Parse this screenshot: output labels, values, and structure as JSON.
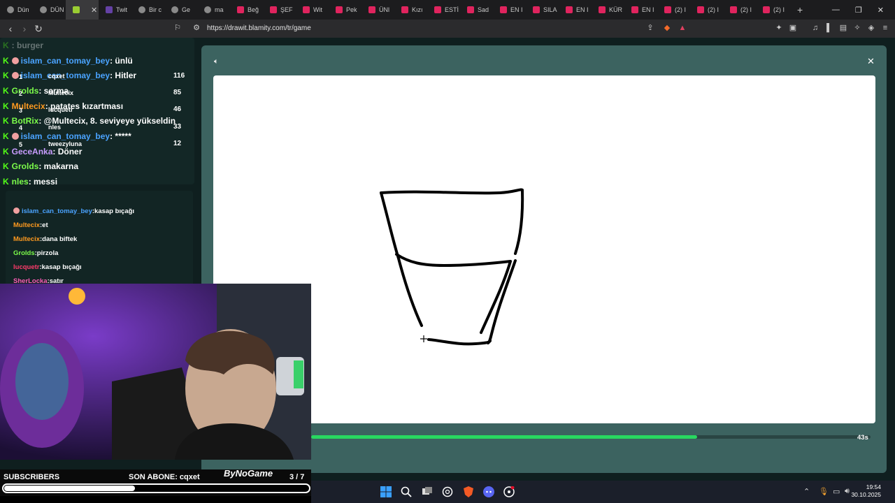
{
  "tabs": [
    {
      "label": "Dün",
      "icon": "globe-icon"
    },
    {
      "label": "DÜN",
      "icon": "globe-icon"
    },
    {
      "label": "",
      "icon": "drawit-icon",
      "active": true
    },
    {
      "label": "Twit",
      "icon": "twitch-icon"
    },
    {
      "label": "Bir c",
      "icon": "globe-icon"
    },
    {
      "label": "Ge",
      "icon": "globe-icon"
    },
    {
      "label": "ma",
      "icon": "globe-icon"
    },
    {
      "label": "Beğ",
      "icon": "youtube-icon"
    },
    {
      "label": "ŞEF",
      "icon": "youtube-icon"
    },
    {
      "label": "Wit",
      "icon": "youtube-icon"
    },
    {
      "label": "Pek",
      "icon": "youtube-icon"
    },
    {
      "label": "ÜNl",
      "icon": "youtube-icon"
    },
    {
      "label": "Kızı",
      "icon": "youtube-icon"
    },
    {
      "label": "ESTİ",
      "icon": "youtube-icon"
    },
    {
      "label": "Sad",
      "icon": "youtube-icon"
    },
    {
      "label": "EN I",
      "icon": "youtube-icon"
    },
    {
      "label": "SILA",
      "icon": "youtube-icon"
    },
    {
      "label": "EN I",
      "icon": "youtube-icon"
    },
    {
      "label": "KÜR",
      "icon": "youtube-icon"
    },
    {
      "label": "EN I",
      "icon": "youtube-icon"
    },
    {
      "label": "(2) I",
      "icon": "youtube-icon"
    },
    {
      "label": "(2) I",
      "icon": "youtube-icon"
    },
    {
      "label": "(2) I",
      "icon": "youtube-icon"
    },
    {
      "label": "(2) I",
      "icon": "youtube-icon"
    }
  ],
  "address": {
    "url": "https://drawit.blamity.com/tr/game"
  },
  "chat": [
    {
      "user": "",
      "text": ": burger",
      "color": "#ff5050"
    },
    {
      "user": "islam_can_tomay_bey",
      "text": ": ünlü",
      "color": "#4aa3ff"
    },
    {
      "user": "islam_can_tomay_bey",
      "text": ": Hitler",
      "color": "#4aa3ff"
    },
    {
      "user": "Grolds",
      "text": ": sarma",
      "color": "#7cfc4a"
    },
    {
      "user": "Multecix",
      "text": ": patates kızartması",
      "color": "#ff9a1f"
    },
    {
      "user": "BotRix",
      "text": ": @Multecix, 8. seviyeye yükseldin",
      "color": "#7cfc4a"
    },
    {
      "user": "islam_can_tomay_bey",
      "text": ": *****",
      "color": "#4aa3ff"
    },
    {
      "user": "GeceAnka",
      "text": ": Döner",
      "color": "#c89cff"
    },
    {
      "user": "Grolds",
      "text": ": makarna",
      "color": "#7cfc4a"
    },
    {
      "user": "nles",
      "text": ": messi",
      "color": "#7cfc4a"
    }
  ],
  "leaderboard": [
    {
      "rank": "1",
      "name": "cqxet",
      "score": "116"
    },
    {
      "rank": "2",
      "name": "Multecix",
      "score": "85"
    },
    {
      "rank": "3",
      "name": "lucquetr",
      "score": "46"
    },
    {
      "rank": "4",
      "name": "nles",
      "score": "33"
    },
    {
      "rank": "5",
      "name": "tweezyluna",
      "score": "12"
    }
  ],
  "guesses": [
    {
      "user": "islam_can_tomay_bey",
      "text": ":kasap bıçağı",
      "color": "#4aa3ff"
    },
    {
      "user": "Multecix",
      "text": ":et",
      "color": "#ff9a1f"
    },
    {
      "user": "Multecix",
      "text": ":dana biftek",
      "color": "#ff9a1f"
    },
    {
      "user": "Grolds",
      "text": ":pirzola",
      "color": "#7cfc4a"
    },
    {
      "user": "lucquetr",
      "text": ":kasap bıçağı",
      "color": "#ff3b6b"
    },
    {
      "user": "SherLocka",
      "text": ":satır",
      "color": "#ff5cb8"
    }
  ],
  "game": {
    "timer_label": "43s",
    "timer_fraction": 0.69
  },
  "overlay": {
    "subscribers_label": "SUBSCRIBERS",
    "son_abone": "SON ABONE: cqxet",
    "sub_count": "3  / 7",
    "sub_fraction": 0.43,
    "logo": "ByNoGame"
  },
  "clock": {
    "time": "19:54",
    "date": "30.10.2025"
  },
  "colors": {
    "accent_green": "#28d860",
    "game_bg": "#3c6360",
    "kick_green": "#53fc18"
  }
}
